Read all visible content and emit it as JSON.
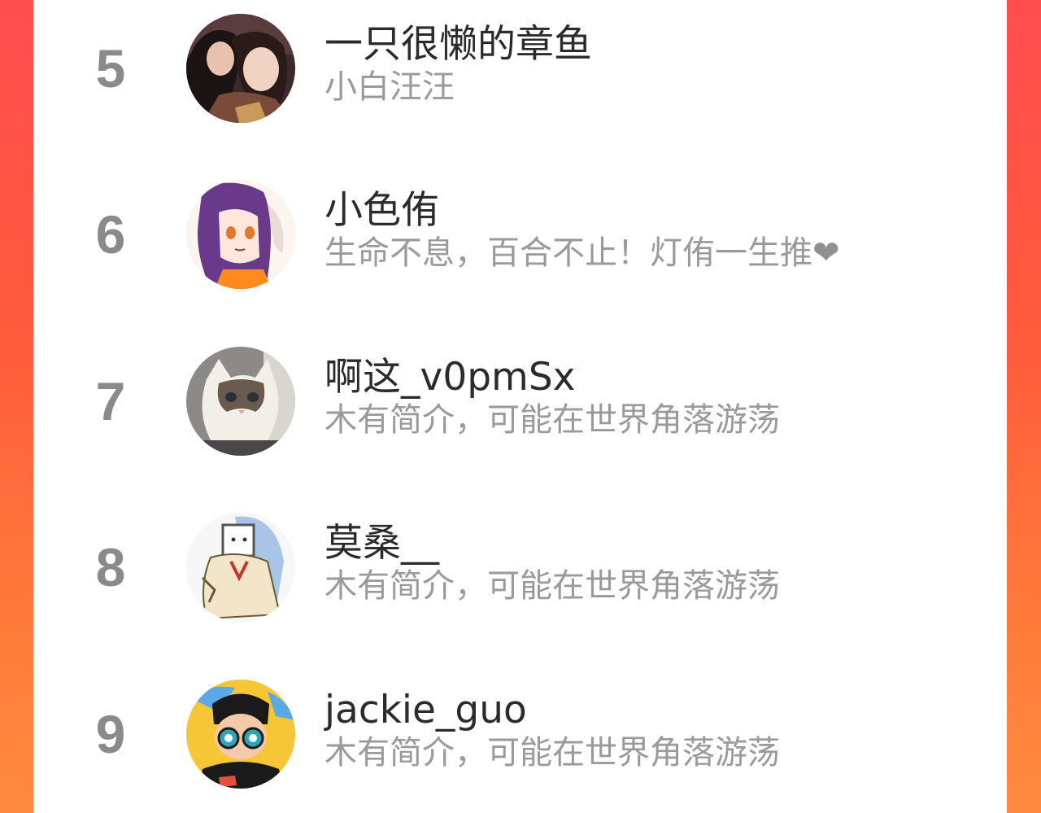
{
  "rankings": [
    {
      "rank": "5",
      "name": "一只很懒的章鱼",
      "bio": "小白汪汪",
      "avatar_icon": "avatar-two-women-photo"
    },
    {
      "rank": "6",
      "name": "小色侑",
      "bio": "生命不息，百合不止！灯侑一生推",
      "bio_suffix": "❤",
      "avatar_icon": "avatar-anime-girl-purple-hair"
    },
    {
      "rank": "7",
      "name": "啊这_v0pmSx",
      "bio": "木有简介，可能在世界角落游荡",
      "avatar_icon": "avatar-ragdoll-cat-photo"
    },
    {
      "rank": "8",
      "name": "莫桑__",
      "bio": "木有简介，可能在世界角落游荡",
      "avatar_icon": "avatar-box-head-character"
    },
    {
      "rank": "9",
      "name": "jackie_guo",
      "bio": "木有简介，可能在世界角落游荡",
      "avatar_icon": "avatar-cartoon-boy-goggles"
    }
  ],
  "colors": {
    "background_gradient_top": "#ff4d4f",
    "background_gradient_bottom": "#ff8a3e",
    "rank_color": "#8a8a8a",
    "name_color": "#2b2b2b",
    "bio_color": "#9a9a9a"
  }
}
